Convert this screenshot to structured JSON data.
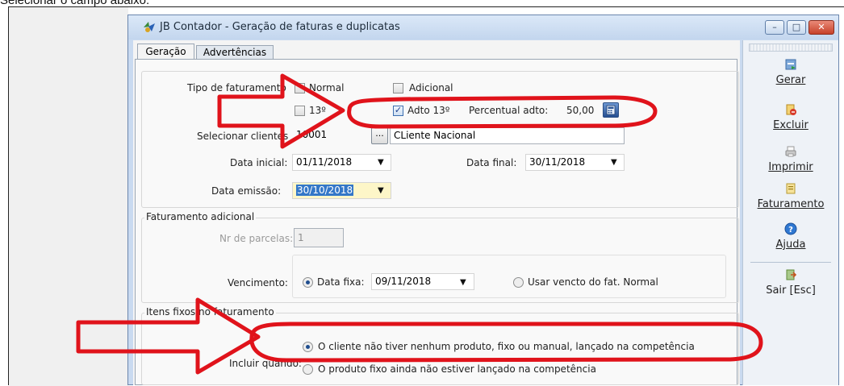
{
  "caption": "Selecionar o campo abaixo:",
  "window": {
    "title": "JB Contador - Geração de faturas e duplicatas",
    "controls": {
      "minimize": "–",
      "maximize": "□",
      "close": "✕"
    }
  },
  "tabs": [
    {
      "label": "Geração",
      "active": true
    },
    {
      "label": "Advertências",
      "active": false
    }
  ],
  "form": {
    "tipo_label": "Tipo de faturamento",
    "normal_label": "Normal",
    "adicional_label": "Adicional",
    "decimo_label": "13º",
    "adto_label": "Adto 13º",
    "adto_checked": true,
    "percentual_label": "Percentual adto:",
    "percentual_value": "50,00",
    "cliente_label": "Selecionar clientes",
    "cliente_code": "10001",
    "cliente_browse": "...",
    "cliente_name": "CLiente Nacional",
    "data_inicial_label": "Data inicial:",
    "data_inicial_value": "01/11/2018",
    "data_final_label": "Data final:",
    "data_final_value": "30/11/2018",
    "data_emissao_label": "Data emissão:",
    "data_emissao_value": "30/10/2018"
  },
  "adicional": {
    "group_label": "Faturamento adicional",
    "parcelas_label": "Nr de parcelas:",
    "parcelas_value": "1",
    "vencimento_label": "Vencimento:",
    "data_fixa_label": "Data fixa:",
    "data_fixa_value": "09/11/2018",
    "usar_vencto_label": "Usar vencto do fat. Normal"
  },
  "itens": {
    "group_label": "Itens fixos no faturamento",
    "incluir_label": "Incluir quando:",
    "option1": "O cliente não tiver nenhum produto, fixo ou manual, lançado na competência",
    "option2": "O produto fixo ainda não estiver lançado na competência"
  },
  "sidebar": {
    "gerar": "Gerar",
    "excluir": "Excluir",
    "imprimir": "Imprimir",
    "faturamento": "Faturamento",
    "ajuda": "Ajuda",
    "sair": "Sair [Esc]"
  },
  "colors": {
    "annotation_red": "#e0131b",
    "selection_blue": "#3377c8",
    "title_bg": "#c3d6ee"
  }
}
